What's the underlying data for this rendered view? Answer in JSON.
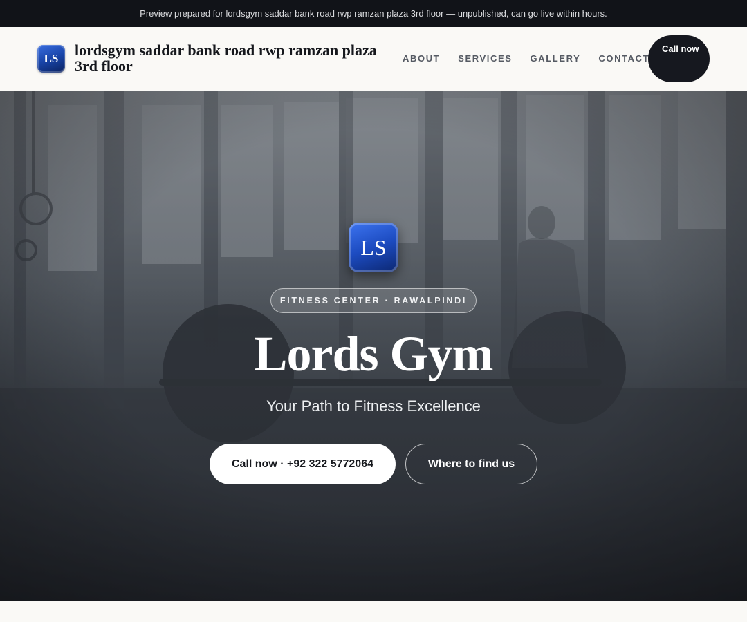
{
  "preview_banner": {
    "text": "Preview prepared for lordsgym saddar bank road rwp ramzan plaza 3rd floor — unpublished, can go live within hours."
  },
  "header": {
    "logo_initials": "LS",
    "brand_name": "lordsgym saddar bank road rwp ramzan plaza 3rd floor",
    "nav": [
      {
        "label": "ABOUT"
      },
      {
        "label": "SERVICES"
      },
      {
        "label": "GALLERY"
      },
      {
        "label": "CONTACT"
      }
    ],
    "cta_label": "Call now"
  },
  "hero": {
    "logo_initials": "LS",
    "eyebrow": "FITNESS CENTER · RAWALPINDI",
    "title": "Lords Gym",
    "subtitle": "Your Path to Fitness Excellence",
    "primary_button": "Call now · +92 322 5772064",
    "secondary_button": "Where to find us"
  },
  "colors": {
    "topbar_bg": "#111318",
    "header_bg": "#faf9f6",
    "brand_blue": "#1c4bc0",
    "cta_dark": "#16181f",
    "hero_text": "#ffffff"
  }
}
